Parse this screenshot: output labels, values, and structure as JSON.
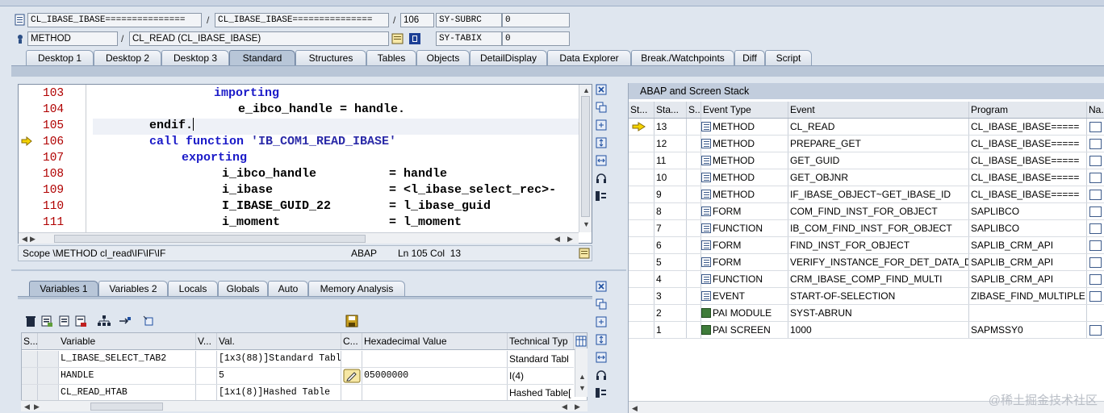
{
  "header": {
    "program1": "CL_IBASE_IBASE===============",
    "program2": "CL_IBASE_IBASE===============",
    "line": "106",
    "subrc_label": "SY-SUBRC",
    "subrc_value": "0",
    "event_type": "METHOD",
    "event": "CL_READ (CL_IBASE_IBASE)",
    "tabix_label": "SY-TABIX",
    "tabix_value": "0",
    "slash": "/"
  },
  "main_tabs": [
    "Desktop 1",
    "Desktop 2",
    "Desktop 3",
    "Standard",
    "Structures",
    "Tables",
    "Objects",
    "DetailDisplay",
    "Data Explorer",
    "Break./Watchpoints",
    "Diff",
    "Script"
  ],
  "active_main_tab": "Standard",
  "code": {
    "lines": [
      {
        "no": "103",
        "text": "importing"
      },
      {
        "no": "104",
        "text": "e_ibco_handle = handle."
      },
      {
        "no": "105",
        "text": "endif."
      },
      {
        "no": "106",
        "text": "call function 'IB_COM1_READ_IBASE'"
      },
      {
        "no": "107",
        "text": "exporting"
      },
      {
        "no": "108",
        "text": "i_ibco_handle          = handle"
      },
      {
        "no": "109",
        "text": "i_ibase                = <l_ibase_select_rec>-"
      },
      {
        "no": "110",
        "text": "I_IBASE_GUID_22        = l_ibase_guid"
      },
      {
        "no": "111",
        "text": "i_moment               = l_moment"
      }
    ]
  },
  "editor_status": {
    "scope": "Scope \\METHOD cl_read\\IF\\IF\\IF",
    "lang": "ABAP",
    "pos": "Ln 105 Col  13"
  },
  "stack": {
    "title": "ABAP and Screen Stack",
    "columns": [
      "St...",
      "Sta...",
      "S...",
      "Event Type",
      "Event",
      "Program",
      "Na..."
    ],
    "rows": [
      {
        "level": "13",
        "type": "METHOD",
        "event": "CL_READ",
        "program": "CL_IBASE_IBASE=====",
        "pai": false,
        "current": true,
        "nav": true
      },
      {
        "level": "12",
        "type": "METHOD",
        "event": "PREPARE_GET",
        "program": "CL_IBASE_IBASE=====",
        "pai": false,
        "current": false,
        "nav": true
      },
      {
        "level": "11",
        "type": "METHOD",
        "event": "GET_GUID",
        "program": "CL_IBASE_IBASE=====",
        "pai": false,
        "current": false,
        "nav": true
      },
      {
        "level": "10",
        "type": "METHOD",
        "event": "GET_OBJNR",
        "program": "CL_IBASE_IBASE=====",
        "pai": false,
        "current": false,
        "nav": true
      },
      {
        "level": "9",
        "type": "METHOD",
        "event": "IF_IBASE_OBJECT~GET_IBASE_ID",
        "program": "CL_IBASE_IBASE=====",
        "pai": false,
        "current": false,
        "nav": true
      },
      {
        "level": "8",
        "type": "FORM",
        "event": "COM_FIND_INST_FOR_OBJECT",
        "program": "SAPLIBCO",
        "pai": false,
        "current": false,
        "nav": true
      },
      {
        "level": "7",
        "type": "FUNCTION",
        "event": "IB_COM_FIND_INST_FOR_OBJECT",
        "program": "SAPLIBCO",
        "pai": false,
        "current": false,
        "nav": true
      },
      {
        "level": "6",
        "type": "FORM",
        "event": "FIND_INST_FOR_OBJECT",
        "program": "SAPLIB_CRM_API",
        "pai": false,
        "current": false,
        "nav": true
      },
      {
        "level": "5",
        "type": "FORM",
        "event": "VERIFY_INSTANCE_FOR_DET_DATA_D",
        "program": "SAPLIB_CRM_API",
        "pai": false,
        "current": false,
        "nav": true
      },
      {
        "level": "4",
        "type": "FUNCTION",
        "event": "CRM_IBASE_COMP_FIND_MULTI",
        "program": "SAPLIB_CRM_API",
        "pai": false,
        "current": false,
        "nav": true
      },
      {
        "level": "3",
        "type": "EVENT",
        "event": "START-OF-SELECTION",
        "program": "ZIBASE_FIND_MULTIPLE",
        "pai": false,
        "current": false,
        "nav": true
      },
      {
        "level": "2",
        "type": "PAI MODULE",
        "event": "SYST-ABRUN",
        "program": "",
        "pai": true,
        "current": false,
        "nav": false
      },
      {
        "level": "1",
        "type": "PAI SCREEN",
        "event": "1000",
        "program": "SAPMSSY0",
        "pai": true,
        "current": false,
        "nav": true
      }
    ]
  },
  "var_tabs": [
    "Variables 1",
    "Variables 2",
    "Locals",
    "Globals",
    "Auto",
    "Memory Analysis"
  ],
  "active_var_tab": "Variables 1",
  "variables": {
    "columns": [
      "S...",
      "Variable",
      "V...",
      "Val.",
      "C...",
      "Hexadecimal Value",
      "Technical Typ"
    ],
    "rows": [
      {
        "name": "L_IBASE_SELECT_TAB2",
        "value": "[1x3(88)]Standard Table",
        "hex": "",
        "type": "Standard Tabl",
        "edit": false
      },
      {
        "name": "HANDLE",
        "value": "5",
        "hex": "05000000",
        "type": "I(4)",
        "edit": true
      },
      {
        "name": "CL_READ_HTAB",
        "value": "[1x1(8)]Hashed Table",
        "hex": "",
        "type": "Hashed Table["
      }
    ]
  },
  "watermark": "@稀土掘金技术社区"
}
